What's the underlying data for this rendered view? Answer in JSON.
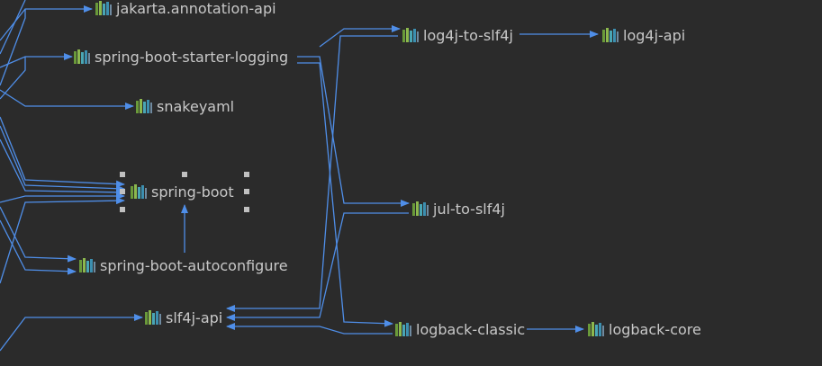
{
  "icon": "library-icon",
  "colors": {
    "background": "#2b2b2b",
    "edge": "#4f8ee8",
    "label": "#c8c8c8",
    "selection_handle": "#c0c0c0",
    "icon_bars": [
      "#6a9a3a",
      "#8cb84e",
      "#4aa6b5",
      "#3c8fb0",
      "#6f8aa0"
    ]
  },
  "nodes": {
    "jakarta_annotation_api": "jakarta.annotation-api",
    "spring_boot_starter_logging": "spring-boot-starter-logging",
    "snakeyaml": "snakeyaml",
    "spring_boot": "spring-boot",
    "spring_boot_autoconfigure": "spring-boot-autoconfigure",
    "slf4j_api": "slf4j-api",
    "log4j_to_slf4j": "log4j-to-slf4j",
    "log4j_api": "log4j-api",
    "jul_to_slf4j": "jul-to-slf4j",
    "logback_classic": "logback-classic",
    "logback_core": "logback-core"
  },
  "selected_node": "spring-boot"
}
